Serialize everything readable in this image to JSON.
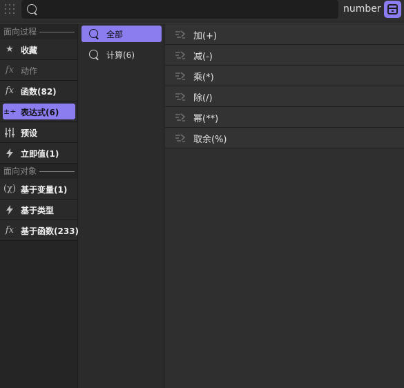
{
  "search": {
    "placeholder": "",
    "value": ""
  },
  "type_label": "number",
  "left": {
    "section1_title": "面向过程",
    "section1_items": [
      {
        "label": "收藏",
        "icon": "star-icon"
      },
      {
        "label": "动作",
        "icon": "fx-icon",
        "dim": true
      },
      {
        "label": "函数(82)",
        "icon": "fx-icon"
      },
      {
        "label": "表达式(6)",
        "icon": "expression-icon",
        "active": true
      },
      {
        "label": "预设",
        "icon": "sliders-icon"
      },
      {
        "label": "立即值(1)",
        "icon": "bolt-icon"
      }
    ],
    "section2_title": "面向对象",
    "section2_items": [
      {
        "label": "基于变量(1)",
        "icon": "variable-icon"
      },
      {
        "label": "基于类型",
        "icon": "bolt-icon"
      },
      {
        "label": "基于函数(233)",
        "icon": "fx-icon"
      }
    ]
  },
  "middle": {
    "items": [
      {
        "label": "全部",
        "icon": "search-icon",
        "active": true
      },
      {
        "label": "计算(6)",
        "icon": "search-icon"
      }
    ]
  },
  "right": {
    "items": [
      {
        "label": "加(+)",
        "icon": "operator-icon"
      },
      {
        "label": "减(-)",
        "icon": "operator-icon"
      },
      {
        "label": "乘(*)",
        "icon": "operator-icon"
      },
      {
        "label": "除(/)",
        "icon": "operator-icon"
      },
      {
        "label": "幂(**)",
        "icon": "operator-icon"
      },
      {
        "label": "取余(%)",
        "icon": "operator-icon"
      }
    ]
  },
  "colors": {
    "accent": "#8b7cf0",
    "background": "#2b2b2b"
  }
}
